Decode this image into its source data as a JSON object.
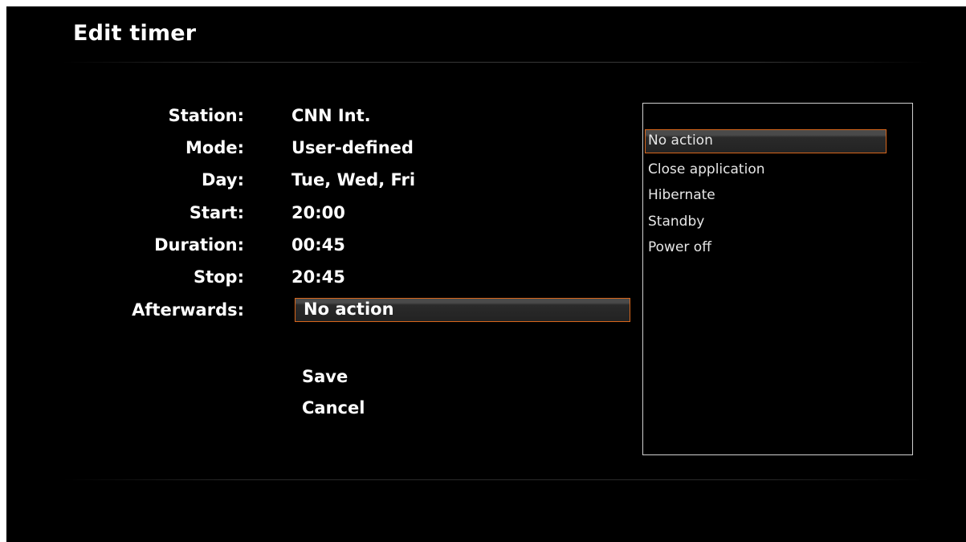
{
  "window": {
    "title": "Edit timer"
  },
  "form": {
    "fields": [
      {
        "label": "Station:",
        "value": "CNN Int."
      },
      {
        "label": "Mode:",
        "value": "User-defined"
      },
      {
        "label": "Day:",
        "value": "Tue, Wed, Fri"
      },
      {
        "label": "Start:",
        "value": "20:00"
      },
      {
        "label": "Duration:",
        "value": "00:45"
      },
      {
        "label": "Stop:",
        "value": "20:45"
      }
    ],
    "afterwards": {
      "label": "Afterwards:",
      "selected": "No action"
    },
    "save_label": "Save",
    "cancel_label": "Cancel"
  },
  "dropdown": {
    "options": [
      "No action",
      "Close application",
      "Hibernate",
      "Standby",
      "Power off"
    ],
    "selected_index": 0
  },
  "colors": {
    "background": "#000000",
    "text": "#ffffff",
    "focus_border": "#d8661c",
    "list_border": "#d0d0d0"
  }
}
